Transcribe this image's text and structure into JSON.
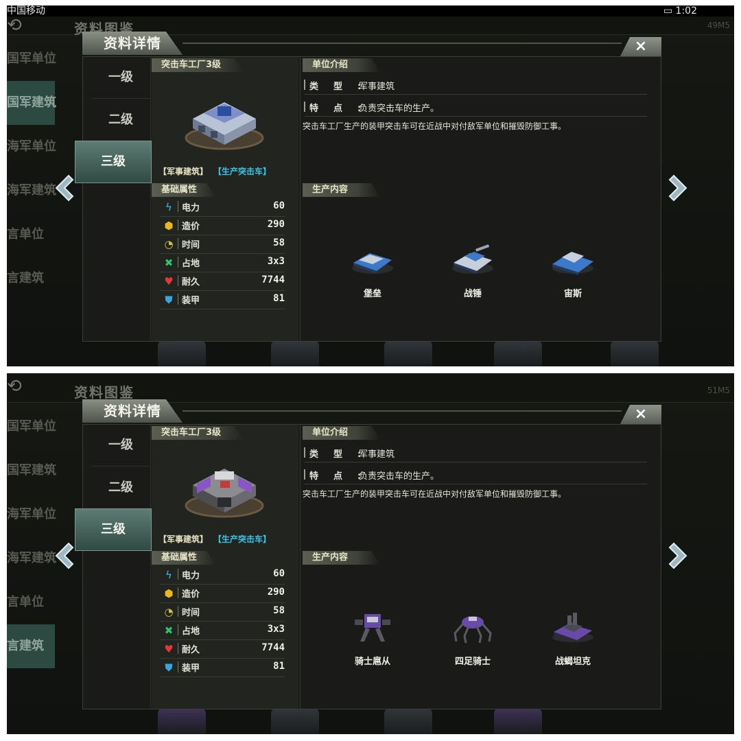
{
  "screenshots": [
    {
      "id": "top",
      "status_bar": {
        "carrier": "中国移动",
        "time": "1:02"
      },
      "background": {
        "title": "资料图鉴",
        "code": "49M5",
        "categories": [
          "陆军单位",
          "陆军建筑",
          "海军单位",
          "海军建筑",
          "空军单位",
          "空军建筑"
        ],
        "categories_shown": [
          "国军单位",
          "国军建筑",
          "海军单位",
          "海军建筑",
          "言单位",
          "言建筑"
        ],
        "active_category": 1
      },
      "dialog": {
        "title": "资料详情",
        "close": "×",
        "levels": [
          "一级",
          "二级",
          "三级"
        ],
        "active_level": 2,
        "building_name": "突击车工厂3级",
        "building_color": "#7d8fc6",
        "tag_type": "【军事建筑】",
        "tag_produce": "【生产突击车】",
        "stats_title": "基础属性",
        "stats": [
          {
            "icon": "lightning-icon",
            "label": "电力",
            "value": "60"
          },
          {
            "icon": "cost-cube-icon",
            "label": "造价",
            "value": "290"
          },
          {
            "icon": "clock-icon",
            "label": "时间",
            "value": "58"
          },
          {
            "icon": "footprint-icon",
            "label": "占地",
            "value": "3x3"
          },
          {
            "icon": "heart-icon",
            "label": "耐久",
            "value": "7744"
          },
          {
            "icon": "shield-icon",
            "label": "装甲",
            "value": "81"
          }
        ],
        "intro_title": "单位介绍",
        "type_key": "类型:",
        "type_value": "军事建筑",
        "feature_key": "特点:",
        "feature_value": "负责突击车的生产。",
        "description": "突击车工厂生产的装甲突击车可在近战中对付敌军单位和摧毁防御工事。",
        "production_title": "生产内容",
        "units": [
          {
            "name": "堡垒",
            "color": "#3d78c9"
          },
          {
            "name": "战锤",
            "color": "#3d78c9"
          },
          {
            "name": "宙斯",
            "color": "#3d78c9"
          }
        ]
      }
    },
    {
      "id": "bottom",
      "status_bar": {
        "carrier": "",
        "time": ""
      },
      "background": {
        "title": "资料图鉴",
        "code": "51M5",
        "categories_shown": [
          "国军单位",
          "国军建筑",
          "海军单位",
          "海军建筑",
          "言单位",
          "言建筑"
        ],
        "active_category": 5
      },
      "dialog": {
        "title": "资料详情",
        "close": "×",
        "levels": [
          "一级",
          "二级",
          "三级"
        ],
        "active_level": 2,
        "building_name": "突击车工厂3级",
        "building_color": "#8a55c4",
        "tag_type": "【军事建筑】",
        "tag_produce": "【生产突击车】",
        "stats_title": "基础属性",
        "stats": [
          {
            "icon": "lightning-icon",
            "label": "电力",
            "value": "60"
          },
          {
            "icon": "cost-cube-icon",
            "label": "造价",
            "value": "290"
          },
          {
            "icon": "clock-icon",
            "label": "时间",
            "value": "58"
          },
          {
            "icon": "footprint-icon",
            "label": "占地",
            "value": "3x3"
          },
          {
            "icon": "heart-icon",
            "label": "耐久",
            "value": "7744"
          },
          {
            "icon": "shield-icon",
            "label": "装甲",
            "value": "81"
          }
        ],
        "intro_title": "单位介绍",
        "type_key": "类型:",
        "type_value": "军事建筑",
        "feature_key": "特点:",
        "feature_value": "负责突击车的生产。",
        "description": "突击车工厂生产的装甲突击车可在近战中对付敌军单位和摧毁防御工事。",
        "production_title": "生产内容",
        "units": [
          {
            "name": "骑士扈从",
            "color": "#6a4aa8"
          },
          {
            "name": "四足骑士",
            "color": "#6a4aa8"
          },
          {
            "name": "战蝎坦克",
            "color": "#6a4aa8"
          }
        ]
      }
    }
  ]
}
